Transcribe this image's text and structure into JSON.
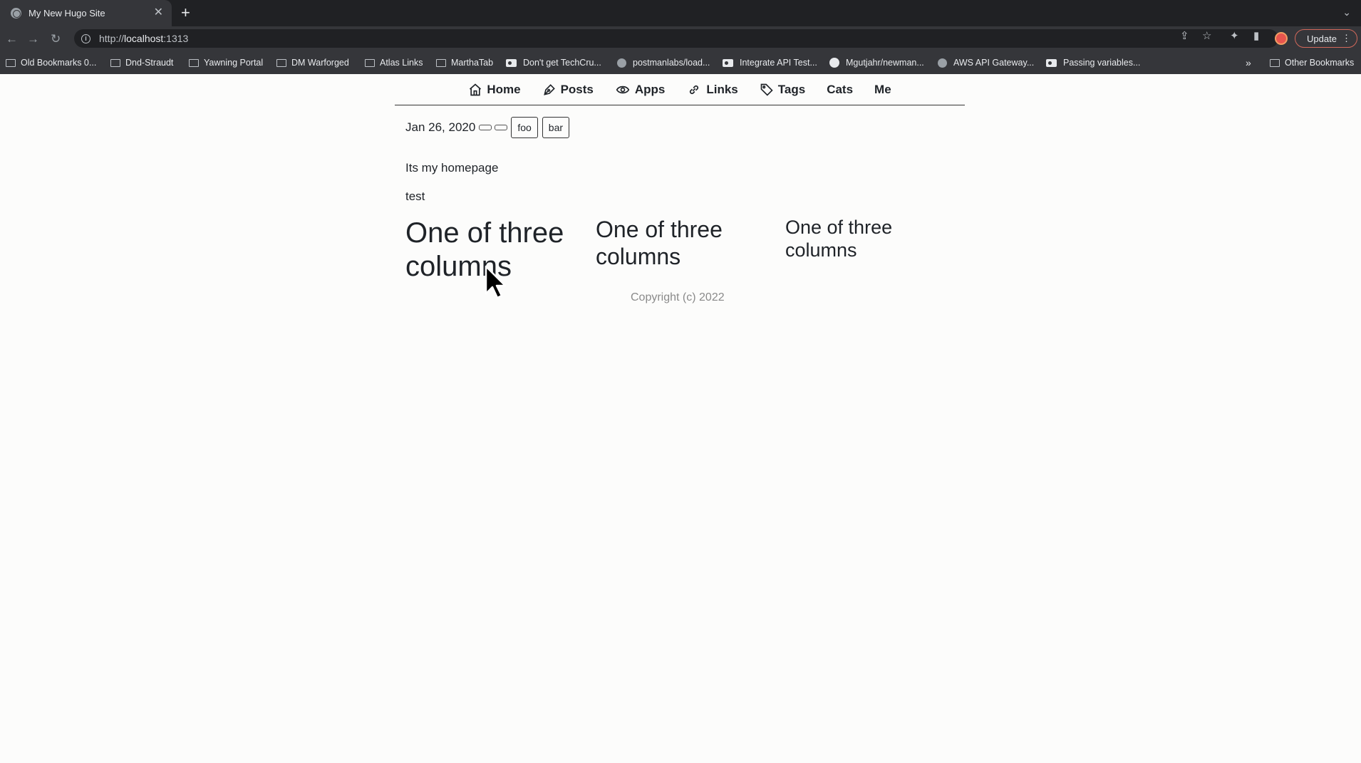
{
  "browser": {
    "tab_title": "My New Hugo Site",
    "url_scheme": "http://",
    "url_host": "localhost",
    "url_port": ":1313",
    "update_label": "Update",
    "bookmarks": [
      {
        "label": "Old Bookmarks 0...",
        "icon": "folder-icon"
      },
      {
        "label": "Dnd-Straudt",
        "icon": "folder-icon"
      },
      {
        "label": "Yawning Portal",
        "icon": "folder-icon"
      },
      {
        "label": "DM Warforged",
        "icon": "folder-icon"
      },
      {
        "label": "Atlas Links",
        "icon": "folder-icon"
      },
      {
        "label": "MarthaTab",
        "icon": "folder-icon"
      },
      {
        "label": "Don't get TechCru...",
        "icon": "medium-icon"
      },
      {
        "label": "postmanlabs/load...",
        "icon": "globe-icon"
      },
      {
        "label": "Integrate API Test...",
        "icon": "medium-icon"
      },
      {
        "label": "Mgutjahr/newman...",
        "icon": "github-icon"
      },
      {
        "label": "AWS API Gateway...",
        "icon": "globe-icon"
      },
      {
        "label": "Passing variables...",
        "icon": "medium-icon"
      }
    ],
    "other_bookmarks": "Other Bookmarks"
  },
  "nav": {
    "items": [
      {
        "label": "Home",
        "icon": "home-icon"
      },
      {
        "label": "Posts",
        "icon": "pen-icon"
      },
      {
        "label": "Apps",
        "icon": "eye-icon"
      },
      {
        "label": "Links",
        "icon": "link-icon"
      },
      {
        "label": "Tags",
        "icon": "tag-icon"
      },
      {
        "label": "Cats",
        "icon": ""
      },
      {
        "label": "Me",
        "icon": ""
      }
    ]
  },
  "post": {
    "date": "Jan 26, 2020",
    "tags": [
      "foo",
      "bar"
    ],
    "paragraphs": [
      "Its my homepage",
      "test"
    ],
    "columns": [
      "One of three columns",
      "One of three columns",
      "One of three columns"
    ]
  },
  "footer": {
    "copyright": "Copyright (c) 2022"
  }
}
